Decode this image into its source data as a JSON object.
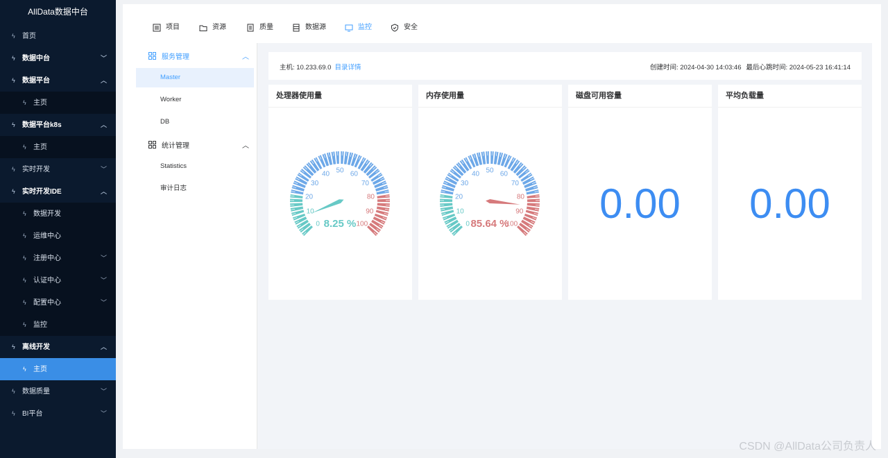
{
  "app": {
    "brand": "AllData数据中台"
  },
  "sidebar": {
    "items": [
      {
        "label": "首页",
        "level": 0,
        "bold": false,
        "arrow": ""
      },
      {
        "label": "数据中台",
        "level": 0,
        "bold": true,
        "arrow": "﹀"
      },
      {
        "label": "数据平台",
        "level": 0,
        "bold": true,
        "arrow": "︿"
      },
      {
        "label": "主页",
        "level": 1,
        "bold": false,
        "arrow": ""
      },
      {
        "label": "数据平台k8s",
        "level": 0,
        "bold": true,
        "arrow": "︿"
      },
      {
        "label": "主页",
        "level": 1,
        "bold": false,
        "arrow": ""
      },
      {
        "label": "实时开发",
        "level": 0,
        "bold": false,
        "arrow": "﹀"
      },
      {
        "label": "实时开发IDE",
        "level": 0,
        "bold": true,
        "arrow": "︿"
      },
      {
        "label": "数据开发",
        "level": 1,
        "bold": false,
        "arrow": ""
      },
      {
        "label": "运维中心",
        "level": 1,
        "bold": false,
        "arrow": ""
      },
      {
        "label": "注册中心",
        "level": 1,
        "bold": false,
        "arrow": "﹀"
      },
      {
        "label": "认证中心",
        "level": 1,
        "bold": false,
        "arrow": "﹀"
      },
      {
        "label": "配置中心",
        "level": 1,
        "bold": false,
        "arrow": "﹀"
      },
      {
        "label": "监控",
        "level": 1,
        "bold": false,
        "arrow": ""
      },
      {
        "label": "离线开发",
        "level": 0,
        "bold": true,
        "arrow": "︿"
      },
      {
        "label": "主页",
        "level": 1,
        "bold": false,
        "arrow": "",
        "active": true
      },
      {
        "label": "数据质量",
        "level": 0,
        "bold": false,
        "arrow": "﹀"
      },
      {
        "label": "BI平台",
        "level": 0,
        "bold": false,
        "arrow": "﹀"
      }
    ]
  },
  "tabs": [
    {
      "label": "项目",
      "icon": "list-icon"
    },
    {
      "label": "资源",
      "icon": "folder-icon"
    },
    {
      "label": "质量",
      "icon": "document-icon"
    },
    {
      "label": "数据源",
      "icon": "database-icon"
    },
    {
      "label": "监控",
      "icon": "monitor-icon",
      "active": true
    },
    {
      "label": "安全",
      "icon": "shield-icon"
    }
  ],
  "subnav": {
    "group1": {
      "label": "服务管理",
      "items": [
        "Master",
        "Worker",
        "DB"
      ]
    },
    "group2": {
      "label": "统计管理",
      "items": [
        "Statistics",
        "审计日志"
      ]
    }
  },
  "host": {
    "label": "主机: 10.233.69.0",
    "link": "目录详情",
    "created": "创建时间: 2024-04-30 14:03:46",
    "heartbeat": "最后心跳时间: 2024-05-23 16:41:14"
  },
  "panels": {
    "cpu": {
      "title": "处理器使用量",
      "value": 8.25,
      "display": "8.25 %"
    },
    "mem": {
      "title": "内存使用量",
      "value": 85.64,
      "display": "85.64 %"
    },
    "disk": {
      "title": "磁盘可用容量",
      "display": "0.00"
    },
    "load": {
      "title": "平均负载量",
      "display": "0.00"
    }
  },
  "gauge": {
    "ticks": [
      "0",
      "10",
      "20",
      "30",
      "40",
      "50",
      "60",
      "70",
      "80",
      "90",
      "100"
    ],
    "colors": {
      "low": "#67c9c6",
      "mid": "#6da8e8",
      "high": "#d67a7c"
    }
  },
  "watermark": "CSDN @AllData公司负责人"
}
